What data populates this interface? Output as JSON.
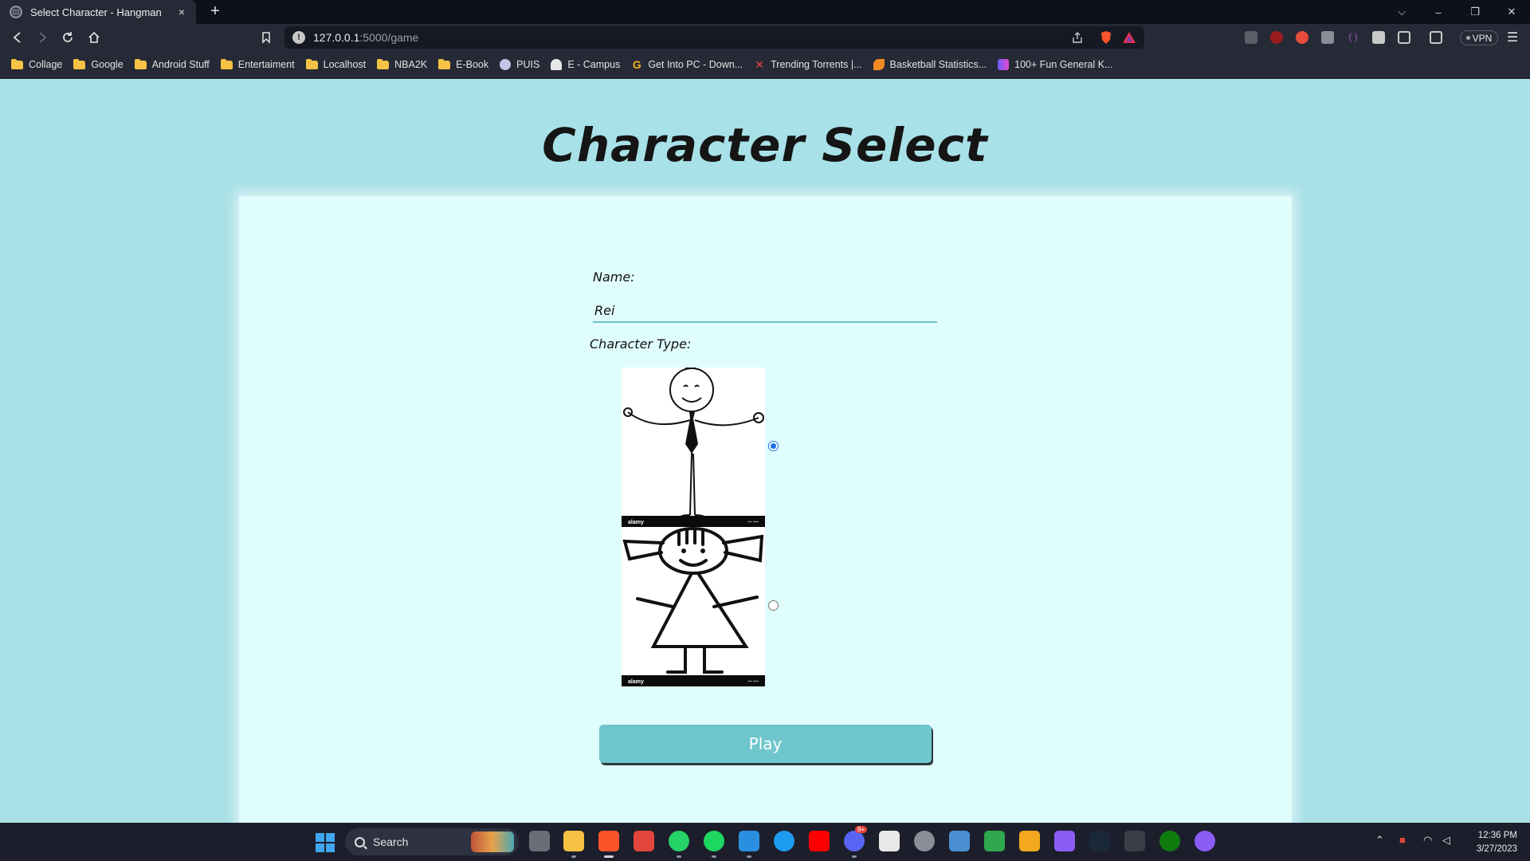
{
  "browser": {
    "tab_title": "Select Character - Hangman",
    "tab_close": "×",
    "new_tab": "+",
    "url_host": "127.0.0.1",
    "url_path": ":5000/game",
    "window_controls": {
      "collapse": "⌵",
      "minimize": "–",
      "restore": "❐",
      "close": "✕"
    },
    "vpn_label": "VPN",
    "bookmarks": [
      {
        "label": "Collage",
        "icon": "folder-icon"
      },
      {
        "label": "Google",
        "icon": "folder-icon"
      },
      {
        "label": "Android Stuff",
        "icon": "folder-icon"
      },
      {
        "label": "Entertaiment",
        "icon": "folder-icon"
      },
      {
        "label": "Localhost",
        "icon": "folder-icon"
      },
      {
        "label": "NBA2K",
        "icon": "folder-icon"
      },
      {
        "label": "E-Book",
        "icon": "folder-icon"
      },
      {
        "label": "PUIS",
        "icon": "puis-icon"
      },
      {
        "label": "E - Campus",
        "icon": "campus-icon"
      },
      {
        "label": "Get Into PC - Down...",
        "icon": "g-icon"
      },
      {
        "label": "Trending Torrents |...",
        "icon": "x-icon"
      },
      {
        "label": "Basketball Statistics...",
        "icon": "basketball-icon"
      },
      {
        "label": "100+ Fun General K...",
        "icon": "book-icon"
      }
    ]
  },
  "page": {
    "title": "Character Select",
    "name_label": "Name:",
    "name_value": "Rei",
    "type_label": "Character Type:",
    "characters": [
      {
        "name": "stick-man",
        "selected": true,
        "watermark": "alamy"
      },
      {
        "name": "stick-girl",
        "selected": false,
        "watermark": "alamy"
      }
    ],
    "play_label": "Play"
  },
  "taskbar": {
    "search_label": "Search",
    "time": "12:36 PM",
    "date": "3/27/2023",
    "discord_badge": "9+"
  },
  "colors": {
    "page_background": "#a8e1e7",
    "card_background": "#e0fdfd",
    "play_button": "#6fc6cc",
    "input_underline": "#6fc2c9",
    "radio_selected": "#1a73e8"
  }
}
